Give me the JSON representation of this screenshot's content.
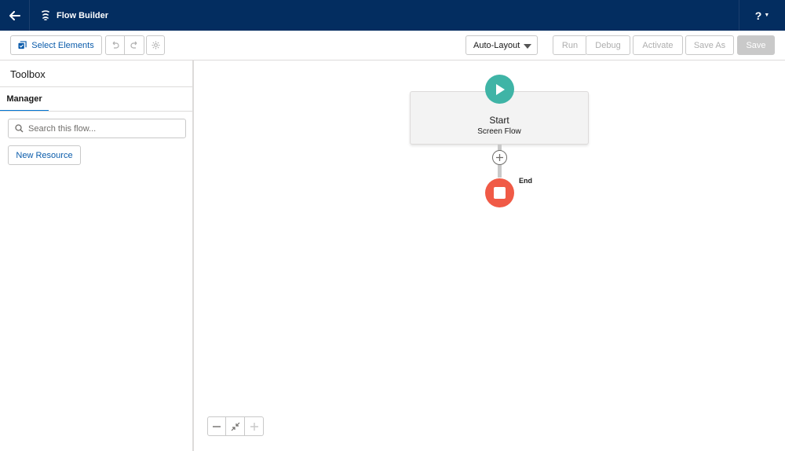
{
  "header": {
    "app_title": "Flow Builder",
    "help_label": "?"
  },
  "toolbar": {
    "select_elements_label": "Select Elements",
    "layout_mode": "Auto-Layout",
    "run_label": "Run",
    "debug_label": "Debug",
    "activate_label": "Activate",
    "save_as_label": "Save As",
    "save_label": "Save"
  },
  "sidebar": {
    "title": "Toolbox",
    "tab_label": "Manager",
    "search_placeholder": "Search this flow...",
    "new_resource_label": "New Resource"
  },
  "canvas": {
    "start_title": "Start",
    "start_subtitle": "Screen Flow",
    "end_label": "End"
  },
  "colors": {
    "header_bg": "#032d60",
    "start_green": "#3fb4a6",
    "end_red": "#f05a46",
    "link_blue": "#0b5cab"
  }
}
